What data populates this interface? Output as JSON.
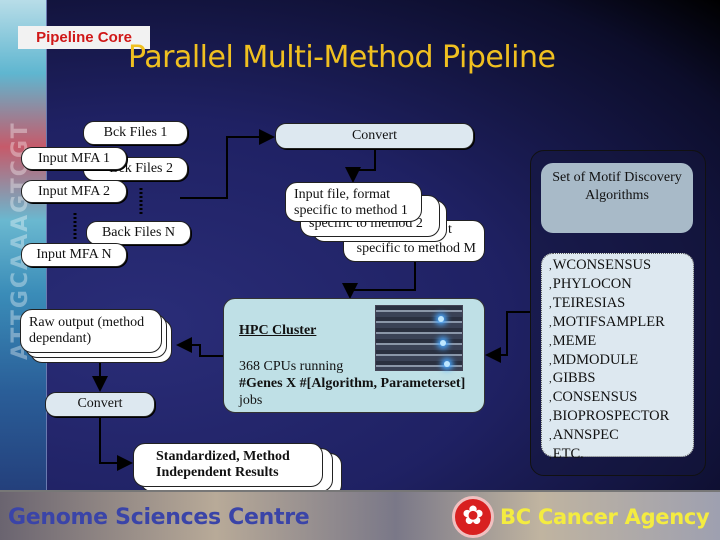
{
  "tag": "Pipeline Core",
  "title": "Parallel Multi-Method Pipeline",
  "inputs": {
    "bck1": "Bck Files 1",
    "bck2": "Bck Files 2",
    "bckN": "Back Files N",
    "mfa1": "Input MFA 1",
    "mfa2": "Input MFA 2",
    "mfaN": "Input MFA N"
  },
  "convert_top": "Convert",
  "method_files": {
    "m1": "Input file, format specific to method 1",
    "m2": "specific to method 2",
    "mM_partial": "t",
    "mM": "specific to method M"
  },
  "hpc": {
    "title": "HPC Cluster",
    "line1": "368 CPUs running",
    "line2": "#Genes X #[Algorithm, Parameterset]",
    "line3": "jobs"
  },
  "raw_output": "Raw output (method dependant)",
  "convert_bottom": "Convert",
  "results": "Standardized, Method Independent Results",
  "algorithm_panel": {
    "header": "Set of Motif Discovery Algorithms",
    "items": [
      "WCONSENSUS",
      "PHYLOCON",
      "TEIRESIAS",
      "MOTIFSAMPLER",
      "MEME",
      "MDMODULE",
      "GIBBS",
      "CONSENSUS",
      "BIOPROSPECTOR",
      "ANNSPEC",
      "ETC."
    ]
  },
  "footer": {
    "left": "Genome Sciences Centre",
    "right": "BC Cancer Agency",
    "logo_icon": "bc-cancer-logo"
  },
  "colors": {
    "title": "#f0c020",
    "tag": "#d01818",
    "footer_right": "#f4ec40",
    "footer_left": "#3a44a8"
  }
}
